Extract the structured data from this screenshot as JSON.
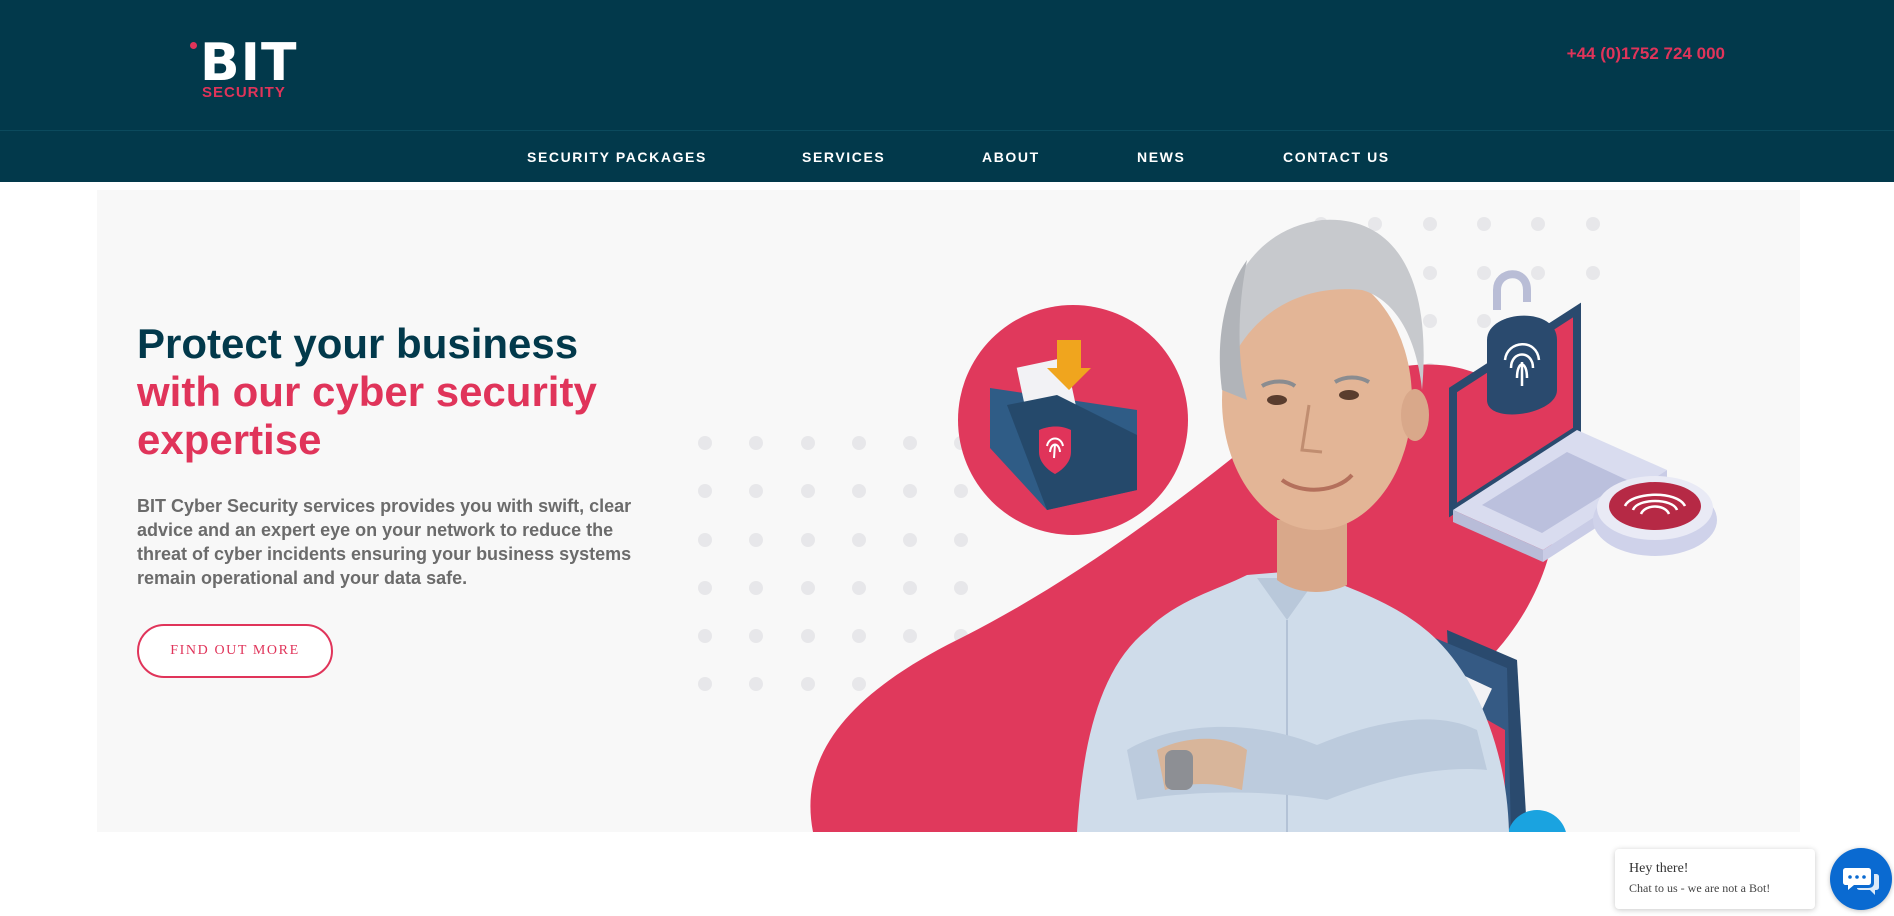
{
  "header": {
    "logo_main": "BIT",
    "logo_sub": "SECURITY",
    "phone": "+44 (0)1752 724 000"
  },
  "nav": {
    "items": [
      "SECURITY PACKAGES",
      "SERVICES",
      "ABOUT",
      "NEWS",
      "CONTACT US"
    ]
  },
  "hero": {
    "headline_line1": "Protect your business",
    "headline_line2": "with our cyber security expertise",
    "body": "BIT Cyber Security services provides you with swift, clear advice and an expert eye on your network to reduce the threat of cyber incidents ensuring your business systems remain operational and your data safe.",
    "cta_label": "FIND OUT MORE"
  },
  "chat": {
    "title": "Hey there!",
    "subtitle": "Chat to us - we are not a Bot!"
  },
  "colors": {
    "navy": "#02394b",
    "accent": "#e0345a",
    "chat_blue": "#0a6ad1",
    "hero_bg": "#f8f8f8"
  },
  "icons": [
    "folder-fingerprint-icon",
    "laptop-lock-icon",
    "fingerprint-pad-icon",
    "phone-mail-icon",
    "shield-icon",
    "chat-icon"
  ]
}
